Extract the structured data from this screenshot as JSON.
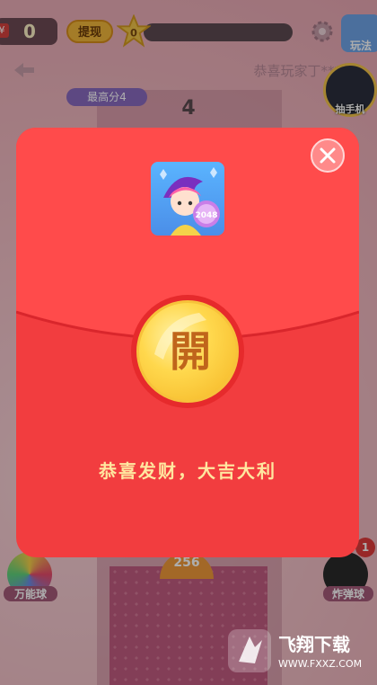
{
  "topbar": {
    "cash_value": "0",
    "withdraw_label": "提现",
    "level_value": "0",
    "howto_label": "玩法"
  },
  "game": {
    "ticker_text": "恭喜玩家丁***",
    "high_score_label": "最高分4",
    "current_score": "4",
    "phone_promo_label": "抽手机",
    "ball_value": "256",
    "spin_ball_label": "万能球",
    "bomb_ball_label": "炸弹球",
    "bomb_badge_count": "1"
  },
  "envelope": {
    "open_char": "開",
    "blessing_text": "恭喜发财，大吉大利"
  },
  "watermark": {
    "title": "飞翔下载",
    "url": "WWW.FXXZ.COM"
  },
  "colors": {
    "envelope_red": "#f23d3f",
    "flap_red": "#ff4b4b",
    "coin_gold": "#ffd84d",
    "blessing_text": "#ffe7a0"
  }
}
